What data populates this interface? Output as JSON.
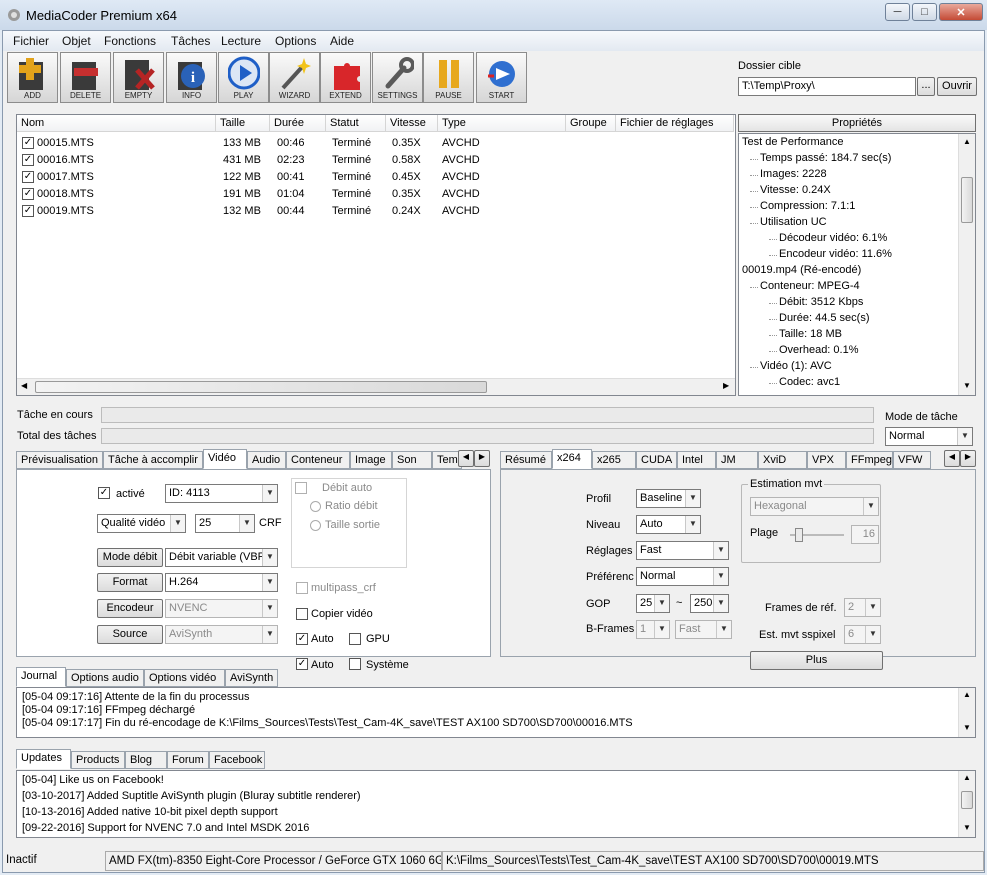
{
  "window": {
    "title": "MediaCoder Premium x64"
  },
  "menu": [
    "Fichier",
    "Objet",
    "Fonctions",
    "Tâches",
    "Lecture",
    "Options",
    "Aide"
  ],
  "toolbar": [
    {
      "label": "ADD",
      "icon": "add-icon",
      "color": "#e2a21a"
    },
    {
      "label": "DELETE",
      "icon": "delete-icon",
      "color": "#c62f2f"
    },
    {
      "label": "EMPTY",
      "icon": "empty-icon",
      "color": "#b52424"
    },
    {
      "label": "INFO",
      "icon": "info-icon",
      "color": "#2a62b8"
    },
    {
      "label": "PLAY",
      "icon": "play-icon",
      "color": "#1f5fc7"
    },
    {
      "label": "WIZARD",
      "icon": "wizard-icon",
      "color": "#6a6a6a"
    },
    {
      "label": "EXTEND",
      "icon": "puzzle-icon",
      "color": "#d8262a"
    },
    {
      "label": "SETTINGS",
      "icon": "wrench-icon",
      "color": "#5a5a5a"
    },
    {
      "label": "PAUSE",
      "icon": "pause-icon",
      "color": "#e7a81d"
    },
    {
      "label": "START",
      "icon": "start-icon",
      "color": "#2f6fd0"
    }
  ],
  "target": {
    "label": "Dossier cible",
    "path": "T:\\Temp\\Proxy\\",
    "browse": "...",
    "open": "Ouvrir"
  },
  "filelist": {
    "columns": [
      "Nom",
      "Taille",
      "Durée",
      "Statut",
      "Vitesse",
      "Type",
      "Groupe",
      "Fichier de réglages"
    ],
    "rows": [
      [
        "00015.MTS",
        "133 MB",
        "00:46",
        "Terminé",
        "0.35X",
        "AVCHD"
      ],
      [
        "00016.MTS",
        "431 MB",
        "02:23",
        "Terminé",
        "0.58X",
        "AVCHD"
      ],
      [
        "00017.MTS",
        "122 MB",
        "00:41",
        "Terminé",
        "0.45X",
        "AVCHD"
      ],
      [
        "00018.MTS",
        "191 MB",
        "01:04",
        "Terminé",
        "0.35X",
        "AVCHD"
      ],
      [
        "00019.MTS",
        "132 MB",
        "00:44",
        "Terminé",
        "0.24X",
        "AVCHD"
      ]
    ]
  },
  "properties": {
    "header": "Propriétés",
    "tree": [
      {
        "t": "Test de Performance",
        "l": 0
      },
      {
        "t": "Temps passé: 184.7 sec(s)",
        "l": 1
      },
      {
        "t": "Images: 2228",
        "l": 1
      },
      {
        "t": "Vitesse: 0.24X",
        "l": 1
      },
      {
        "t": "Compression: 7.1:1",
        "l": 1
      },
      {
        "t": "Utilisation UC",
        "l": 1
      },
      {
        "t": "Décodeur vidéo: 6.1%",
        "l": 2
      },
      {
        "t": "Encodeur vidéo: 11.6%",
        "l": 2
      },
      {
        "t": "00019.mp4 (Ré-encodé)",
        "l": 0
      },
      {
        "t": "Conteneur: MPEG-4",
        "l": 1
      },
      {
        "t": "Débit: 3512 Kbps",
        "l": 2
      },
      {
        "t": "Durée: 44.5 sec(s)",
        "l": 2
      },
      {
        "t": "Taille: 18 MB",
        "l": 2
      },
      {
        "t": "Overhead: 0.1%",
        "l": 2
      },
      {
        "t": "Vidéo (1): AVC",
        "l": 1
      },
      {
        "t": "Codec: avc1",
        "l": 2
      }
    ]
  },
  "progress": {
    "current_label": "Tâche en cours",
    "total_label": "Total des tâches",
    "mode_label": "Mode de tâche",
    "mode_value": "Normal"
  },
  "left_tabs": [
    "Prévisualisation",
    "Tâche à accomplir",
    "Vidéo",
    "Audio",
    "Conteneur",
    "Image",
    "Son",
    "Tem"
  ],
  "video": {
    "active_label": "activé",
    "id_value": "ID: 4113",
    "quality_value": "Qualité vidéo",
    "crf_value": "25",
    "crf_label": "CRF",
    "debit_btn": "Mode débit",
    "debit_value": "Débit variable (VBR",
    "format_btn": "Format",
    "format_value": "H.264",
    "encoder_btn": "Encodeur",
    "encoder_value": "NVENC",
    "source_btn": "Source",
    "source_value": "AviSynth",
    "debit_auto": "Débit auto",
    "ratio": "Ratio débit",
    "taille": "Taille sortie",
    "multipass": "multipass_crf",
    "copy": "Copier vidéo",
    "auto1": "Auto",
    "gpu": "GPU",
    "auto2": "Auto",
    "system": "Système"
  },
  "right_tabs": [
    "Résumé",
    "x264",
    "x265",
    "CUDA",
    "Intel",
    "JM",
    "XviD",
    "VPX",
    "FFmpeg",
    "VFW"
  ],
  "x264": {
    "profil_label": "Profil",
    "profil_value": "Baseline",
    "niveau_label": "Niveau",
    "niveau_value": "Auto",
    "reglages_label": "Réglages",
    "reglages_value": "Fast",
    "pref_label": "Préférenc",
    "pref_value": "Normal",
    "gop_label": "GOP",
    "gop_min": "25",
    "gop_sep": "~",
    "gop_max": "250",
    "bframes_label": "B-Frames",
    "bframes_value": "1",
    "bframes_mode": "Fast",
    "me_group": "Estimation mvt",
    "me_value": "Hexagonal",
    "plage_label": "Plage",
    "plage_value": "16",
    "refs_label": "Frames de réf.",
    "refs_value": "2",
    "subpel_label": "Est. mvt sspixel",
    "subpel_value": "6",
    "more_btn": "Plus"
  },
  "log_tabs": [
    "Journal",
    "Options audio",
    "Options vidéo",
    "AviSynth"
  ],
  "log": [
    "[05-04 09:17:16] Attente de la fin du processus",
    "[05-04 09:17:16] FFmpeg déchargé",
    "[05-04 09:17:17] Fin du ré-encodage de K:\\Films_Sources\\Tests\\Test_Cam-4K_save\\TEST AX100 SD700\\SD700\\00016.MTS"
  ],
  "news_tabs": [
    "Updates",
    "Products",
    "Blog",
    "Forum",
    "Facebook"
  ],
  "news": [
    "[05-04] Like us on Facebook!",
    "[03-10-2017] Added Suptitle AviSynth plugin (Bluray subtitle renderer)",
    "[10-13-2016] Added native 10-bit pixel depth support",
    "[09-22-2016] Support for NVENC 7.0 and Intel MSDK 2016"
  ],
  "status": {
    "state": "Inactif",
    "hw": "AMD FX(tm)-8350 Eight-Core Processor  / GeForce GTX 1060 6G",
    "file": "K:\\Films_Sources\\Tests\\Test_Cam-4K_save\\TEST AX100 SD700\\SD700\\00019.MTS"
  }
}
